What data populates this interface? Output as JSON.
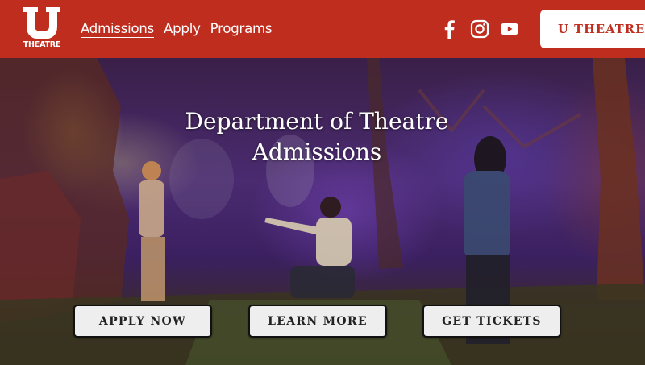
{
  "logo": {
    "text": "THEATRE",
    "icon": "u-block-logo"
  },
  "nav": {
    "items": [
      {
        "label": "Admissions",
        "active": true
      },
      {
        "label": "Apply",
        "active": false
      },
      {
        "label": "Programs",
        "active": false
      }
    ]
  },
  "social": {
    "icons": [
      "facebook-icon",
      "instagram-icon",
      "youtube-icon"
    ]
  },
  "header": {
    "site_button_label": "U THEATRE"
  },
  "hero": {
    "title_line1": "Department of Theatre",
    "title_line2": "Admissions",
    "buttons": {
      "apply": "APPLY NOW",
      "learn": "LEARN MORE",
      "tickets": "GET TICKETS"
    }
  },
  "colors": {
    "brand_red": "#be2d1e",
    "button_bg": "#eeeeee"
  }
}
